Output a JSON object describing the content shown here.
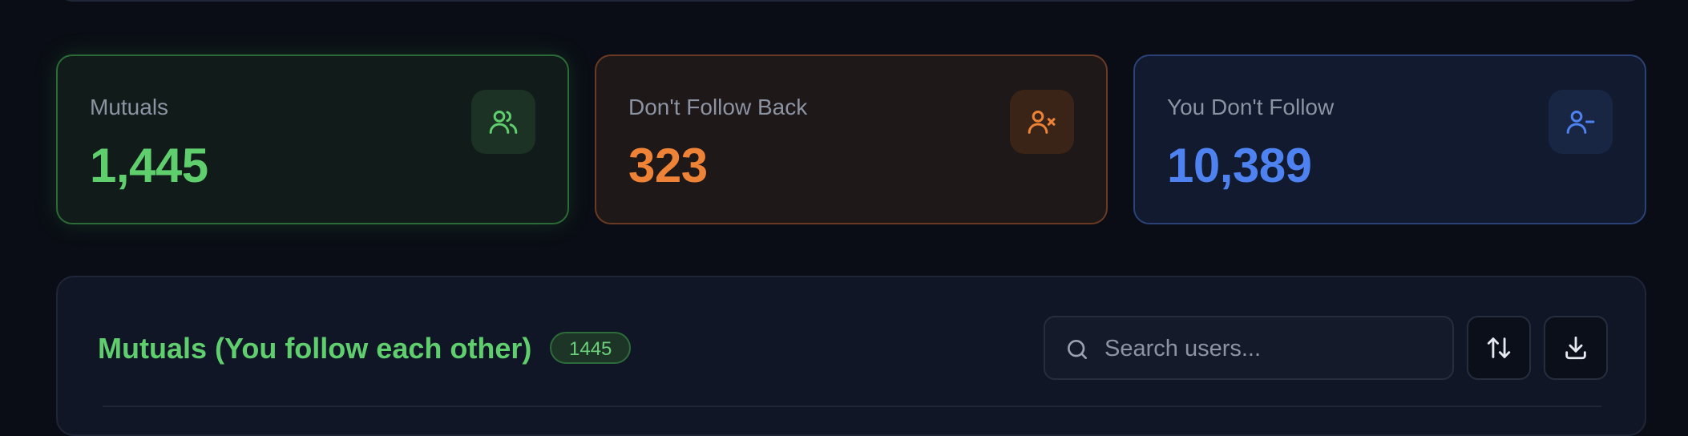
{
  "stats": [
    {
      "label": "Mutuals",
      "value": "1,445",
      "icon": "users-icon",
      "color": "#5fcf6e"
    },
    {
      "label": "Don't Follow Back",
      "value": "323",
      "icon": "user-x-icon",
      "color": "#ee8236"
    },
    {
      "label": "You Don't Follow",
      "value": "10,389",
      "icon": "user-minus-icon",
      "color": "#4d82f0"
    }
  ],
  "list": {
    "title": "Mutuals (You follow each other)",
    "count": "1445",
    "search_placeholder": "Search users...",
    "search_value": "",
    "sort_icon": "sort-arrows-icon",
    "download_icon": "download-icon"
  }
}
